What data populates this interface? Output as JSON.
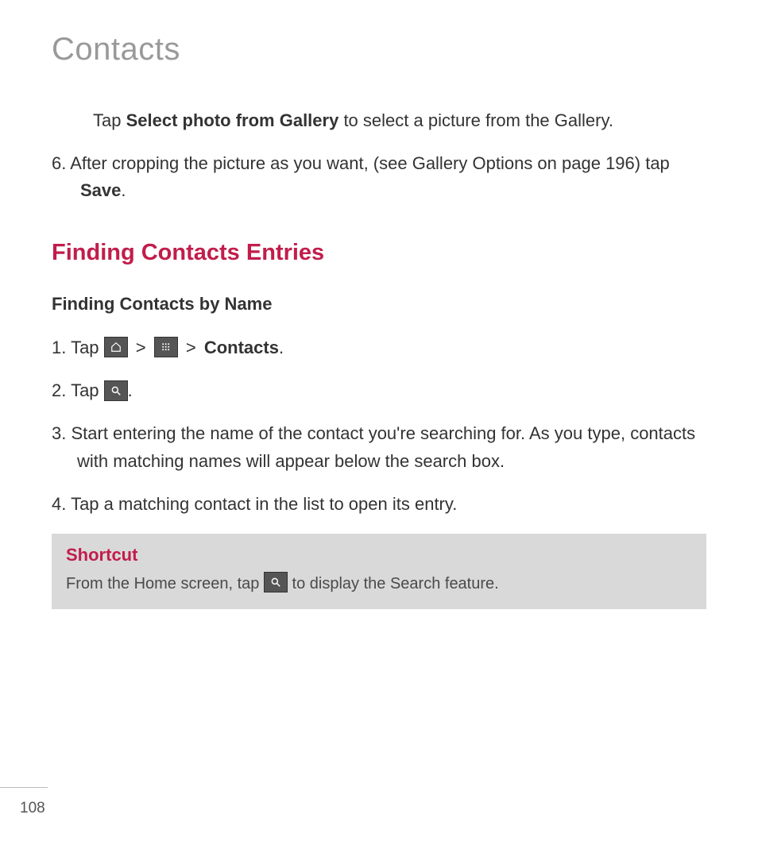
{
  "page": {
    "title": "Contacts",
    "number": "108"
  },
  "intro": {
    "prefix": "Tap ",
    "bold": "Select photo from Gallery",
    "suffix": " to select a picture from the Gallery."
  },
  "step6": {
    "num": "6. ",
    "text_a": "After cropping the picture as you want, (see Gallery Options on page 196) tap ",
    "bold": "Save",
    "suffix": "."
  },
  "section": {
    "heading": "Finding Contacts Entries",
    "subheading": "Finding Contacts by Name"
  },
  "steps": {
    "s1": {
      "num": "1. ",
      "a": "Tap ",
      "gt1": " > ",
      "gt2": " > ",
      "bold": "Contacts",
      "suffix": "."
    },
    "s2": {
      "num": "2. ",
      "a": "Tap ",
      "suffix": "."
    },
    "s3": {
      "num": "3. ",
      "text": "Start entering the name of the contact you're searching for. As you type, contacts with matching names will appear below the search box."
    },
    "s4": {
      "num": "4. ",
      "text": "Tap a matching contact in the list to open its entry."
    }
  },
  "shortcut": {
    "title": "Shortcut",
    "a": "From the Home screen, tap ",
    "b": " to display the Search feature."
  },
  "icons": {
    "home": "home-icon",
    "apps": "apps-icon",
    "search": "search-icon"
  }
}
